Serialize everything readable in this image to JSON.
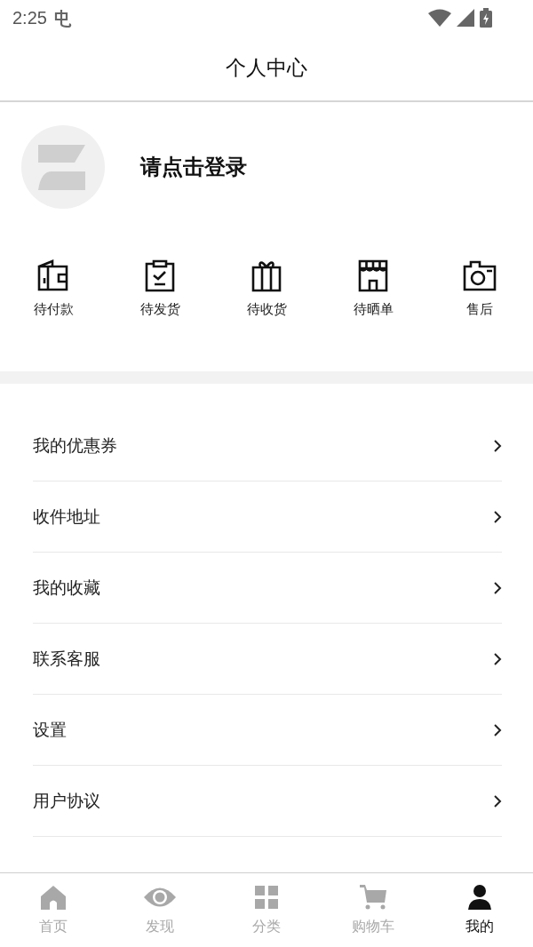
{
  "status_bar": {
    "time": "2:25"
  },
  "header": {
    "title": "个人中心"
  },
  "profile": {
    "login_prompt": "请点击登录"
  },
  "orders": [
    {
      "label": "待付款",
      "kind": "wallet"
    },
    {
      "label": "待发货",
      "kind": "clipboard"
    },
    {
      "label": "待收货",
      "kind": "gift"
    },
    {
      "label": "待晒单",
      "kind": "store"
    },
    {
      "label": "售后",
      "kind": "camera"
    }
  ],
  "menu": [
    {
      "label": "我的优惠券"
    },
    {
      "label": "收件地址"
    },
    {
      "label": "我的收藏"
    },
    {
      "label": "联系客服"
    },
    {
      "label": "设置"
    },
    {
      "label": "用户协议"
    }
  ],
  "tab_bar": [
    {
      "label": "首页",
      "kind": "home",
      "selected": false
    },
    {
      "label": "发现",
      "kind": "eye",
      "selected": false
    },
    {
      "label": "分类",
      "kind": "grid",
      "selected": false
    },
    {
      "label": "购物车",
      "kind": "cart",
      "selected": false
    },
    {
      "label": "我的",
      "kind": "person",
      "selected": true
    }
  ]
}
